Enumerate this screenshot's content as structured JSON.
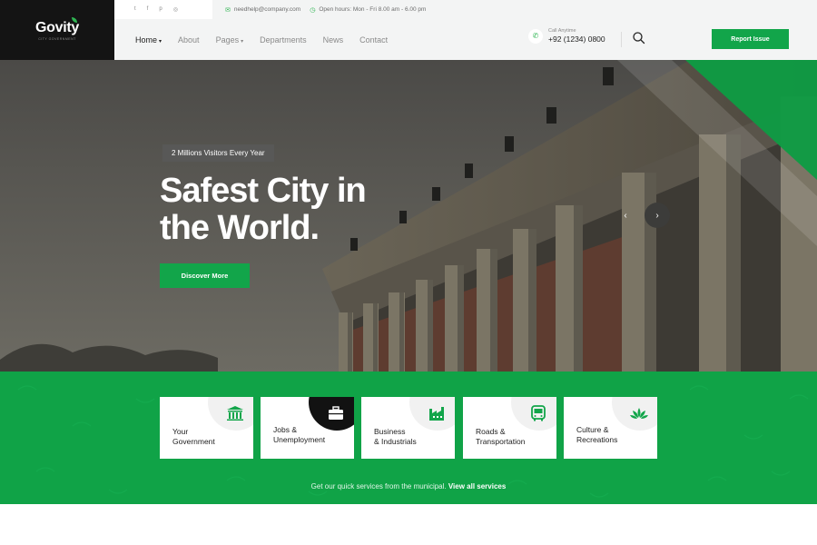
{
  "brand": {
    "name": "Govity",
    "tagline": "CITY GOVERNMENT"
  },
  "colors": {
    "accent": "#12a54a",
    "dark": "#141414",
    "service_bg": "#10a347"
  },
  "topbar": {
    "social": [
      {
        "icon": "twitter-icon",
        "glyph": "t"
      },
      {
        "icon": "facebook-icon",
        "glyph": "f"
      },
      {
        "icon": "pinterest-icon",
        "glyph": "p"
      },
      {
        "icon": "instagram-icon",
        "glyph": "◎"
      }
    ],
    "email": "needhelp@company.com",
    "hours": "Open hours: Mon - Fri 8.00 am - 6.00 pm"
  },
  "nav": {
    "items": [
      {
        "label": "Home",
        "active": true,
        "dropdown": true
      },
      {
        "label": "About",
        "active": false,
        "dropdown": false
      },
      {
        "label": "Pages",
        "active": false,
        "dropdown": true
      },
      {
        "label": "Departments",
        "active": false,
        "dropdown": false
      },
      {
        "label": "News",
        "active": false,
        "dropdown": false
      },
      {
        "label": "Contact",
        "active": false,
        "dropdown": false
      }
    ],
    "call_label": "Call Anytime",
    "call_number": "+92 (1234) 0800",
    "report_label": "Report Issue"
  },
  "hero": {
    "badge": "2 Millions Visitors Every Year",
    "title_line1": "Safest City in",
    "title_line2": "the World.",
    "cta": "Discover More",
    "prev": "‹",
    "next": "›"
  },
  "services": {
    "cards": [
      {
        "label": "Your\nGovernment",
        "icon": "government-building-icon",
        "dark": false
      },
      {
        "label": "Jobs &\nUnemployment",
        "icon": "briefcase-icon",
        "dark": true
      },
      {
        "label": "Business\n& Industrials",
        "icon": "factory-icon",
        "dark": false
      },
      {
        "label": "Roads &\nTransportation",
        "icon": "bus-icon",
        "dark": false
      },
      {
        "label": "Culture &\nRecreations",
        "icon": "lotus-icon",
        "dark": false
      }
    ],
    "text": "Get our quick services from the municipal.",
    "link": "View all services"
  }
}
